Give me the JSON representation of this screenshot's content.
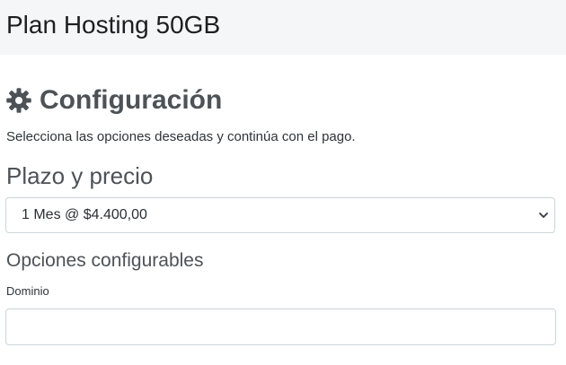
{
  "product": {
    "title": "Plan Hosting 50GB"
  },
  "config": {
    "heading": "Configuración",
    "heading_icon": "gear-icon",
    "subtitle": "Selecciona las opciones deseadas y continúa con el pago."
  },
  "term": {
    "heading": "Plazo y precio",
    "selected_option": "1 Mes @ $4.400,00",
    "chevron_icon": "chevron-down-icon"
  },
  "options": {
    "heading": "Opciones configurables",
    "domain_label": "Dominio",
    "domain_value": "",
    "domain_placeholder": ""
  },
  "colors": {
    "header_bg": "#f5f6f8",
    "heading_gray": "#4d5257",
    "border": "#ced4da"
  }
}
